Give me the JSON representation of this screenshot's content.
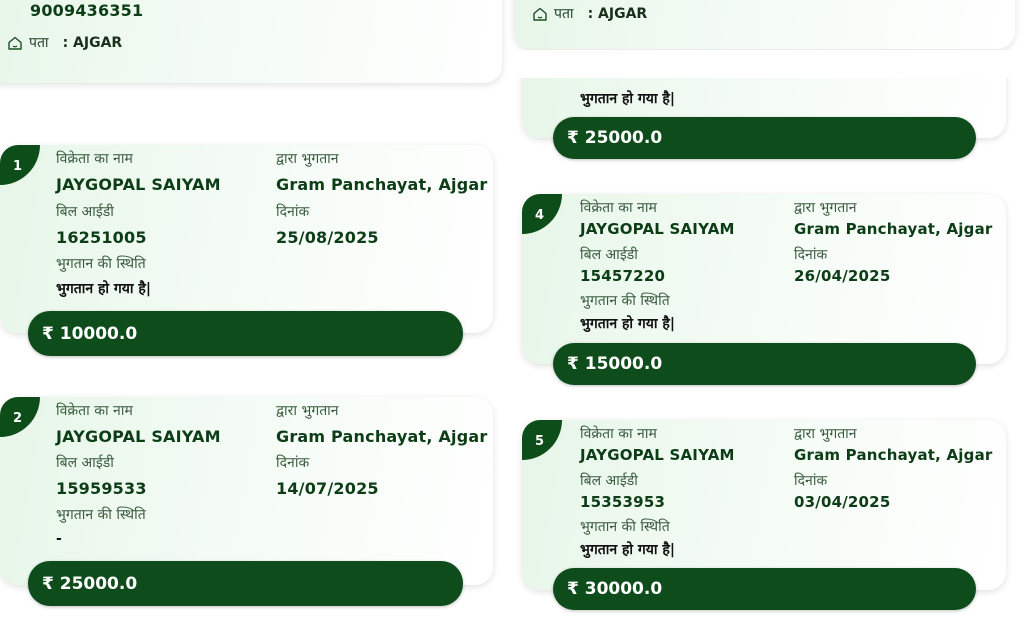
{
  "top_left": {
    "phone": "9009436351",
    "address_label": "पता",
    "address_sep": ":",
    "address_value": "AJGAR"
  },
  "top_right": {
    "address_label": "पता",
    "address_sep": ":",
    "address_value": "AJGAR"
  },
  "partial_card": {
    "status": "भुगतान हो गया है|",
    "amount": "₹ 25000.0"
  },
  "labels": {
    "vendor": "विक्रेता का नाम",
    "paid_by": "द्वारा भुगतान",
    "bill_id": "बिल आईडी",
    "date": "दिनांक",
    "payment_status": "भुगतान की स्थिति"
  },
  "payments": [
    {
      "index": "1",
      "vendor": "JAYGOPAL SAIYAM",
      "paid_by": "Gram Panchayat, Ajgar",
      "bill_id": "16251005",
      "date": "25/08/2025",
      "status": "भुगतान हो गया है|",
      "amount": "₹ 10000.0"
    },
    {
      "index": "2",
      "vendor": "JAYGOPAL SAIYAM",
      "paid_by": "Gram Panchayat, Ajgar",
      "bill_id": "15959533",
      "date": "14/07/2025",
      "status": "-",
      "amount": "₹ 25000.0"
    },
    {
      "index": "4",
      "vendor": "JAYGOPAL SAIYAM",
      "paid_by": "Gram Panchayat, Ajgar",
      "bill_id": "15457220",
      "date": "26/04/2025",
      "status": "भुगतान हो गया है|",
      "amount": "₹ 15000.0"
    },
    {
      "index": "5",
      "vendor": "JAYGOPAL SAIYAM",
      "paid_by": "Gram Panchayat, Ajgar",
      "bill_id": "15353953",
      "date": "03/04/2025",
      "status": "भुगतान हो गया है|",
      "amount": "₹ 30000.0"
    }
  ],
  "colors": {
    "accent": "#0e4d1b",
    "card_bg": "#e7f6e9"
  },
  "icons": {
    "address": "home-icon"
  }
}
